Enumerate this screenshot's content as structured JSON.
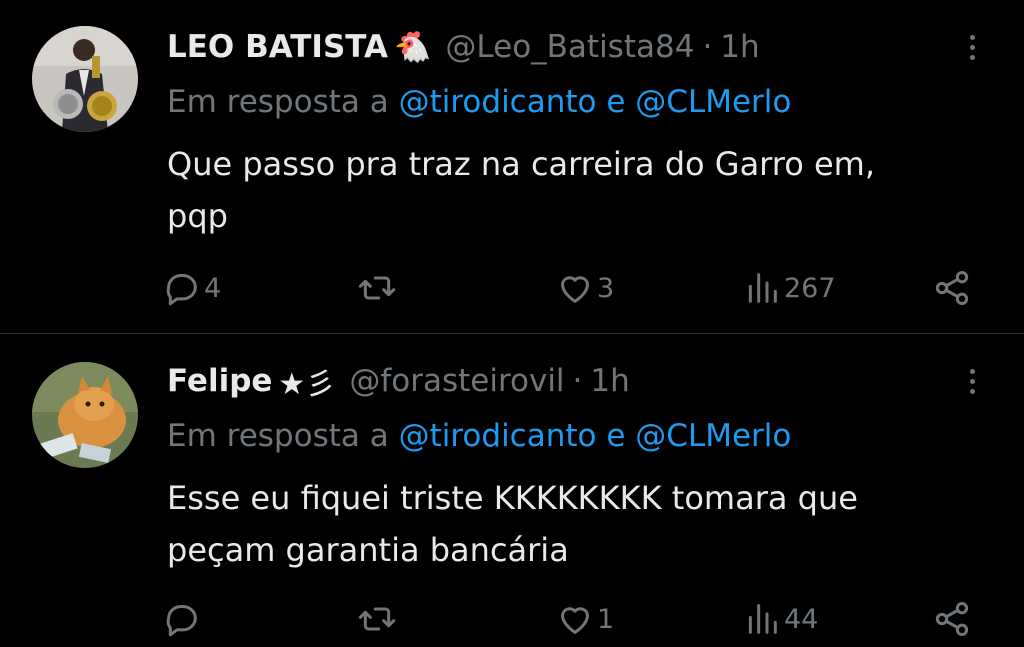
{
  "tweets": [
    {
      "display_name": "LEO BATISTA",
      "name_decoration": "🐔",
      "handle": "@Leo_Batista84",
      "separator": "·",
      "time": "1h",
      "reply_prefix": "Em resposta a",
      "reply_mention_1": "@tirodicanto",
      "reply_conjunction": "e",
      "reply_mention_2": "@CLMerlo",
      "body_line_1": "Que passo pra traz na carreira do Garro em,",
      "body_line_2": "pqp",
      "replies": "4",
      "retweets": "",
      "likes": "3",
      "views": "267"
    },
    {
      "display_name": "Felipe",
      "name_decoration": "★彡",
      "handle": "@forasteirovil",
      "separator": "·",
      "time": "1h",
      "reply_prefix": "Em resposta a",
      "reply_mention_1": "@tirodicanto",
      "reply_conjunction": "e",
      "reply_mention_2": "@CLMerlo",
      "body_line_1": "Esse eu fiquei triste KKKKKKKK tomara que",
      "body_line_2": "peçam garantia bancária",
      "replies": "",
      "retweets": "",
      "likes": "1",
      "views": "44"
    }
  ],
  "icons": {
    "reply": "reply-icon",
    "retweet": "retweet-icon",
    "like": "heart-icon",
    "views": "views-icon",
    "share": "share-icon",
    "more": "more-icon"
  },
  "colors": {
    "background": "#000000",
    "text": "#e7e9ea",
    "secondary": "#71767b",
    "mention": "#1d9bf0",
    "divider": "#2f3336"
  }
}
